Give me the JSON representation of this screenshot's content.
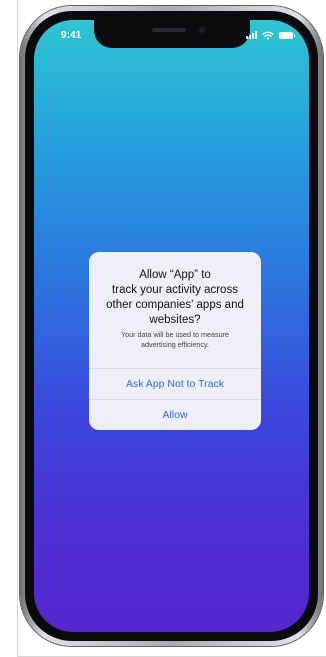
{
  "status_bar": {
    "time": "9:41",
    "icons": [
      "signal-icon",
      "wifi-icon",
      "battery-icon"
    ]
  },
  "alert": {
    "title": "Allow “App” to\ntrack your activity across\nother companies' apps and\nwebsites?",
    "message": "Your data will be used to measure advertising efficiency.",
    "buttons": {
      "primary": "Ask App Not to Track",
      "secondary": "Allow"
    }
  },
  "colors": {
    "gradient_top": "#2ec5d1",
    "gradient_bottom": "#5527cf",
    "action_blue": "#2f6ee8"
  }
}
